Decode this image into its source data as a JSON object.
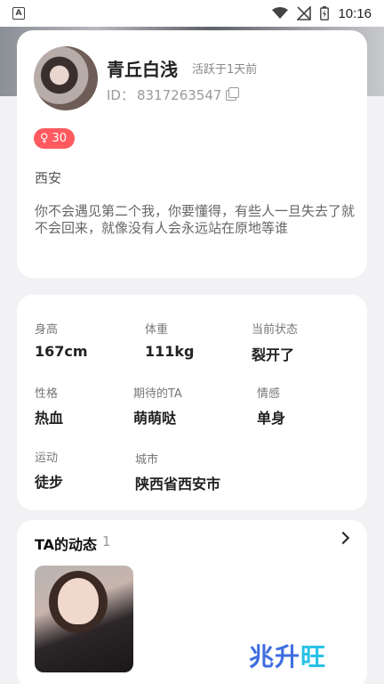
{
  "status_bar": {
    "time": "10:16"
  },
  "profile": {
    "name": "青丘白浅",
    "active": "活跃于1天前",
    "id_label": "ID：",
    "id_value": "8317263547",
    "gender_symbol": "♀",
    "age": "30",
    "city": "西安",
    "bio": "你不会遇见第二个我，你要懂得，有些人一旦失去了就不会回来，就像没有人会永远站在原地等谁"
  },
  "info": {
    "height_label": "身高",
    "height_value": "167cm",
    "weight_label": "体重",
    "weight_value": "111kg",
    "status_label": "当前状态",
    "status_value": "裂开了",
    "personality_label": "性格",
    "personality_value": "热血",
    "expect_label": "期待的TA",
    "expect_value": "萌萌哒",
    "relationship_label": "情感",
    "relationship_value": "单身",
    "sport_label": "运动",
    "sport_value": "徒步",
    "city_label": "城市",
    "city_value": "陕西省西安市"
  },
  "moments": {
    "title": "TA的动态",
    "count": "1"
  },
  "watermark": {
    "part1": "兆升",
    "part2": "旺"
  },
  "colors": {
    "gender_badge": "#ff5a5f",
    "card": "#ffffff",
    "background": "#f2f2f4"
  }
}
